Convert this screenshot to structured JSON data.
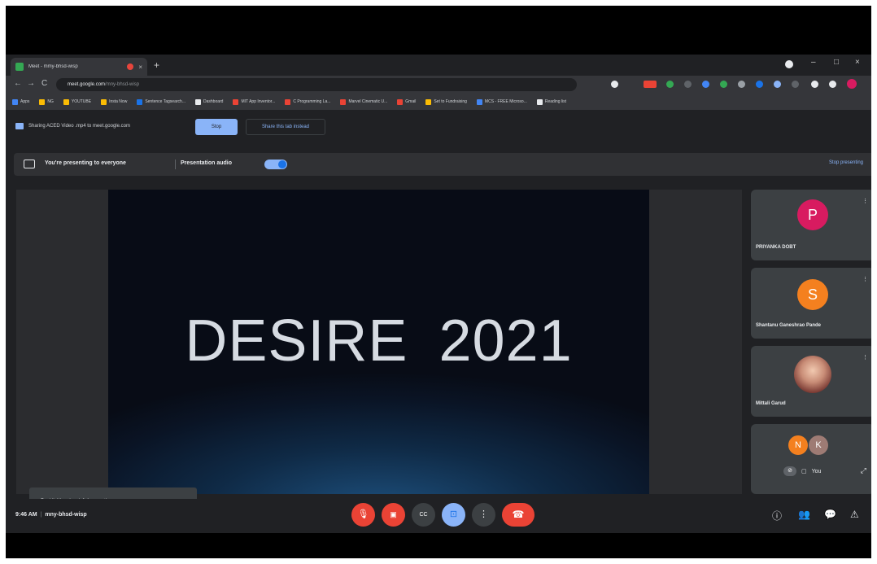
{
  "browser": {
    "tab_title": "Meet - mmy-bhsd-wisp",
    "new_tab": "+",
    "window_controls": [
      "–",
      "□",
      "×"
    ],
    "nav": {
      "back": "←",
      "forward": "→",
      "reload": "C"
    },
    "address": {
      "host": "meet.google.com",
      "path": "/mny-bhsd-wisp"
    },
    "bookmarks": [
      {
        "label": "Apps",
        "color": "#4285f4"
      },
      {
        "label": "NG",
        "color": "#fbbc04"
      },
      {
        "label": "YOUTUBE",
        "color": "#fbbc04"
      },
      {
        "label": "Insta Now",
        "color": "#fbbc04"
      },
      {
        "label": "Sentence Tagsearch...",
        "color": "#1a73e8"
      },
      {
        "label": "Dashboard",
        "color": "#e8eaed"
      },
      {
        "label": "MIT App Inventor...",
        "color": "#ea4335"
      },
      {
        "label": "C Programming La...",
        "color": "#ea4335"
      },
      {
        "label": "Marvel Cinematic U...",
        "color": "#ea4335"
      },
      {
        "label": "Gmail",
        "color": "#ea4335"
      },
      {
        "label": "Set to Fundraising",
        "color": "#fbbc04"
      },
      {
        "label": "MCS - FREE Microso...",
        "color": "#4285f4"
      },
      {
        "label": "Reading list",
        "color": "#e8eaed"
      }
    ],
    "sharing": {
      "message": "Sharing ACED Video .mp4 to meet.google.com",
      "stop_label": "Stop",
      "share_this_label": "Share this tab instead"
    }
  },
  "meet": {
    "banner": {
      "presenting_text": "You're presenting to everyone",
      "audio_label": "Presentation audio",
      "stop_presenting": "Stop presenting"
    },
    "slide": {
      "word1": "DESIRE",
      "word2": "2021"
    },
    "toast": "Rushik Maru has left the meeting",
    "participants": [
      {
        "initial": "P",
        "name": "PRIYANKA DOBT",
        "color": "#d81b60"
      },
      {
        "initial": "S",
        "name": "Shantanu Ganeshrao Pande",
        "color": "#f4801f"
      },
      {
        "initial": "",
        "name": "Mittali Garud",
        "color": ""
      }
    ],
    "self_tile": {
      "avatars": [
        {
          "initial": "N",
          "color": "#f4801f"
        },
        {
          "initial": "K",
          "color": "#9e7b74"
        }
      ],
      "you_label": "You"
    },
    "tile_menu_icon": "⋮",
    "bottom_bar": {
      "time": "9:46 AM",
      "separator": "|",
      "meeting_code": "mny-bhsd-wisp",
      "controls": [
        {
          "name": "mic-off-icon",
          "glyph": "🎙",
          "color": "#ea4335"
        },
        {
          "name": "camera-off-icon",
          "glyph": "▣",
          "color": "#ea4335"
        },
        {
          "name": "captions-icon",
          "glyph": "CC",
          "color": "#3c4043"
        },
        {
          "name": "present-icon",
          "glyph": "⊡",
          "color": "#8ab4f8"
        },
        {
          "name": "more-options-icon",
          "glyph": "⋮",
          "color": "#3c4043"
        }
      ],
      "end_call_glyph": "☎",
      "right_icons": [
        "ⓘ",
        "👥",
        "💬",
        "⚠"
      ]
    }
  }
}
